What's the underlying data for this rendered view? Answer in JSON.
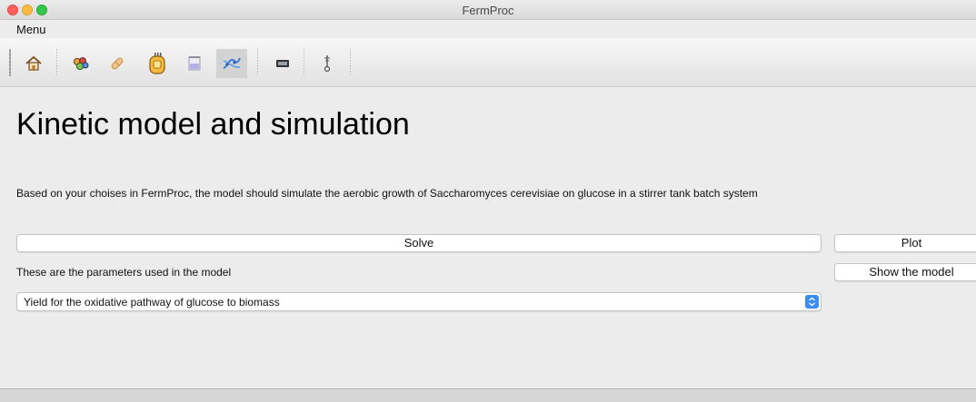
{
  "window": {
    "title": "FermProc"
  },
  "menubar": {
    "menu_label": "Menu"
  },
  "toolbar": {
    "buttons": [
      {
        "icon": "home-icon"
      },
      {
        "icon": "cells-icon"
      },
      {
        "icon": "capsule-icon"
      },
      {
        "icon": "bioreactor-icon"
      },
      {
        "icon": "beaker-icon"
      },
      {
        "icon": "kinetic-model-icon",
        "active": true
      },
      {
        "icon": "display-icon"
      },
      {
        "icon": "probe-icon"
      }
    ]
  },
  "main": {
    "title": "Kinetic model and simulation",
    "description": "Based on your choises in FermProc, the model should simulate the aerobic growth of Saccharomyces cerevisiae on glucose in a stirrer tank batch system",
    "solve_label": "Solve",
    "plot_label": "Plot",
    "parameters_label": "These are the parameters used in the model",
    "show_model_label": "Show the model",
    "parameter_select": {
      "selected": "Yield for the oxidative pathway of glucose to biomass"
    }
  }
}
